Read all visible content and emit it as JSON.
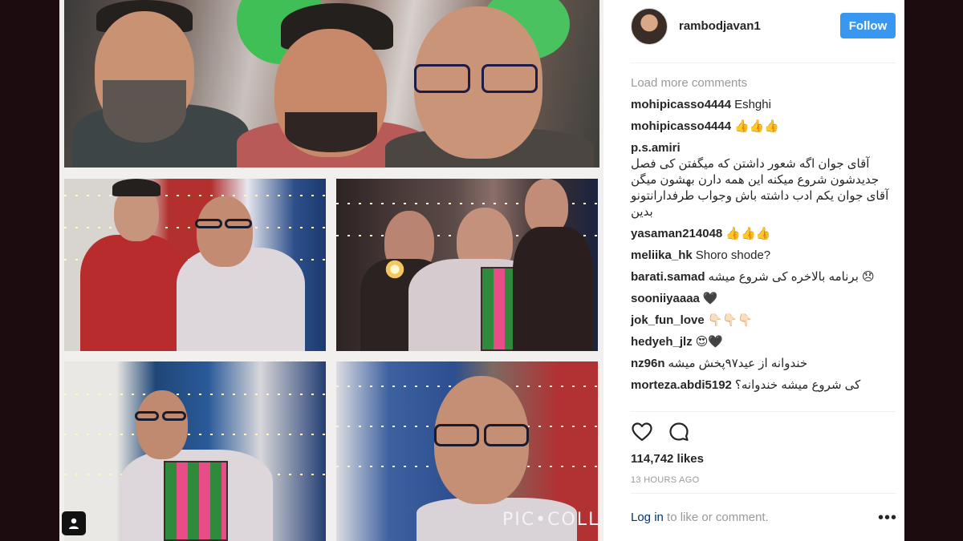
{
  "post": {
    "username": "rambodjavan1",
    "follow_label": "Follow",
    "watermark": "PIC•COLLAGE"
  },
  "comments_section": {
    "load_more": "Load more comments",
    "items": [
      {
        "author": "mohipicasso4444",
        "text": "Eshghi"
      },
      {
        "author": "mohipicasso4444",
        "text": "👍👍👍"
      },
      {
        "author": "p.s.amiri",
        "text": "آقای جوان اگه شعور داشتن که میگفتن کی فصل جدیدشون شروع میکنه این همه دارن بهشون میگن آقای جوان یکم ادب داشته باش وجواب طرفدارانتونو بدین"
      },
      {
        "author": "yasaman214048",
        "text": "👍👍👍"
      },
      {
        "author": "meliika_hk",
        "text": "Shoro shode?"
      },
      {
        "author": "barati.samad",
        "text": "برنامه بالاخره کی شروع میشه 😞"
      },
      {
        "author": "sooniiyaaaa",
        "text": "🖤"
      },
      {
        "author": "jok_fun_love",
        "text": "👇🏻👇🏻👇🏻"
      },
      {
        "author": "hedyeh_jlz",
        "text": "😍🖤"
      },
      {
        "author": "nz96n",
        "text": "خندوانه از عید۹۷پخش میشه"
      },
      {
        "author": "morteza.abdi5192",
        "text": "کی شروع میشه خندوانه؟"
      }
    ]
  },
  "actions": {
    "like_icon": "heart-icon",
    "comment_icon": "comment-bubble-icon"
  },
  "stats": {
    "likes": "114,742 likes",
    "time": "13 HOURS AGO"
  },
  "footer": {
    "login_link": "Log in",
    "login_rest": " to like or comment.",
    "more": "•••"
  }
}
